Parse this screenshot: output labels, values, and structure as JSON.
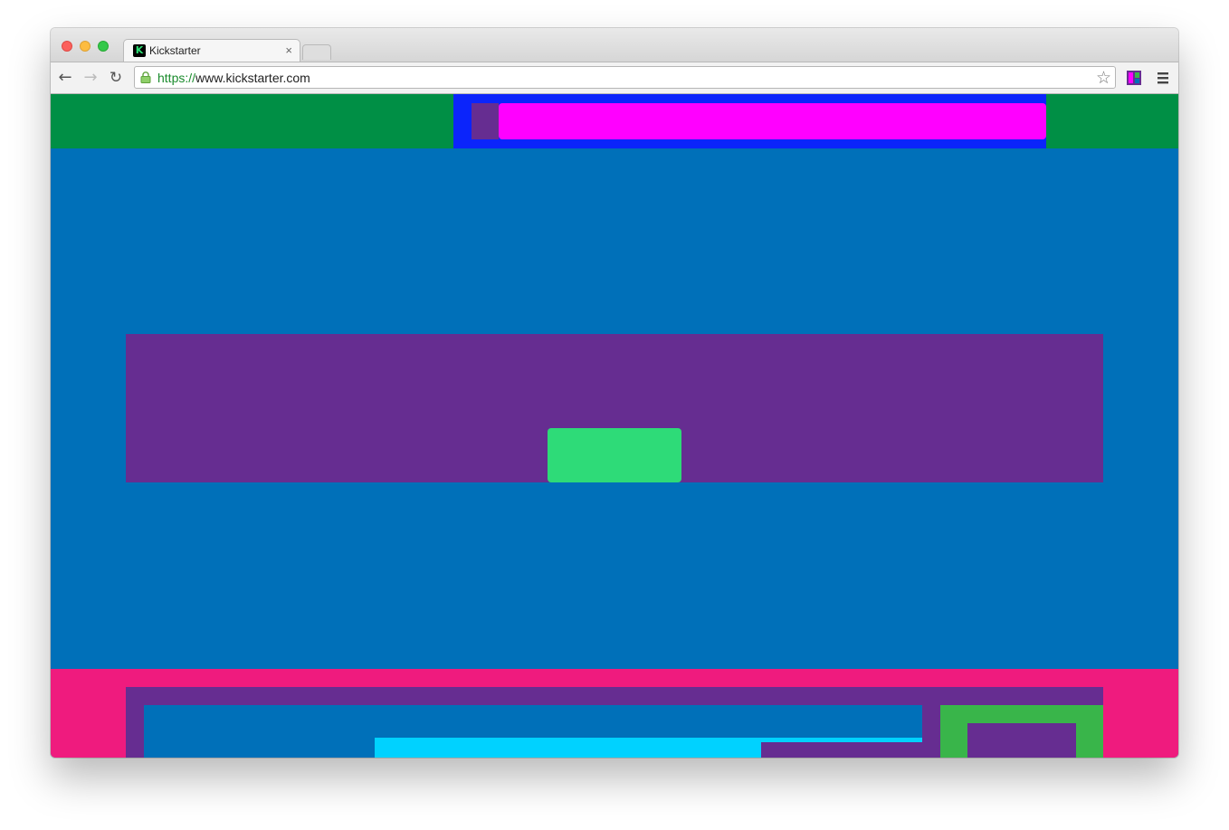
{
  "browser": {
    "tab": {
      "title": "Kickstarter",
      "favicon_letter": "K",
      "close_glyph": "×"
    },
    "address_bar": {
      "scheme": "https://",
      "host": "www.kickstarter.com"
    },
    "nav": {
      "back_glyph": "←",
      "forward_glyph": "→",
      "reload_glyph": "↻",
      "bookmark_glyph": "☆"
    }
  },
  "colors": {
    "header_green": "#008f45",
    "header_blue": "#0b24fb",
    "search_pink": "#ff00ff",
    "purple": "#662d91",
    "page_blue": "#0070b9",
    "cta_green": "#2edb78",
    "footer_pink": "#ef1b7e",
    "footer_green": "#39b54a",
    "cyan": "#00d2ff"
  }
}
